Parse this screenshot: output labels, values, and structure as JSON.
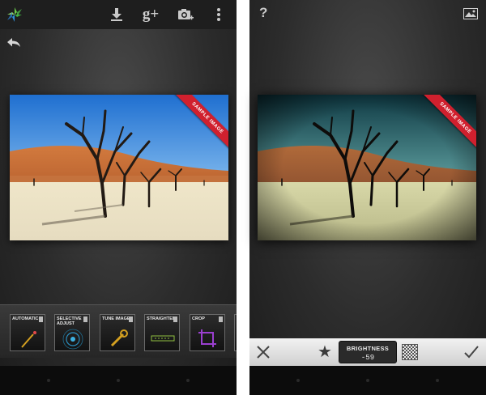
{
  "left_screen": {
    "toolbar": {
      "app_icon": "snapseed-logo-icon",
      "icons": [
        "download-icon",
        "google-plus-icon",
        "camera-add-icon",
        "overflow-menu-icon"
      ],
      "google_plus_label": "g+"
    },
    "back_icon": "back-arrow-icon",
    "image": {
      "ribbon": "SAMPLE IMAGE"
    },
    "tools": [
      {
        "label": "AUTOMATIC",
        "icon": "magic-wand-icon"
      },
      {
        "label": "SELECTIVE ADJUST",
        "icon": "control-point-icon"
      },
      {
        "label": "TUNE IMAGE",
        "icon": "wrench-icon"
      },
      {
        "label": "STRAIGHTEN",
        "icon": "straighten-icon"
      },
      {
        "label": "CROP",
        "icon": "crop-icon"
      }
    ]
  },
  "right_screen": {
    "help_label": "?",
    "compare_icon": "image-compare-icon",
    "image": {
      "ribbon": "SAMPLE IMAGE"
    },
    "edit_bar": {
      "cancel_icon": "close-icon",
      "favorite_icon": "star-icon",
      "parameter": {
        "name": "BRIGHTNESS",
        "value": "-59"
      },
      "texture_icon": "checkerboard-icon",
      "apply_icon": "checkmark-icon"
    }
  },
  "colors": {
    "accent_ribbon": "#d0202e",
    "tool_accent": "#d4a020"
  }
}
